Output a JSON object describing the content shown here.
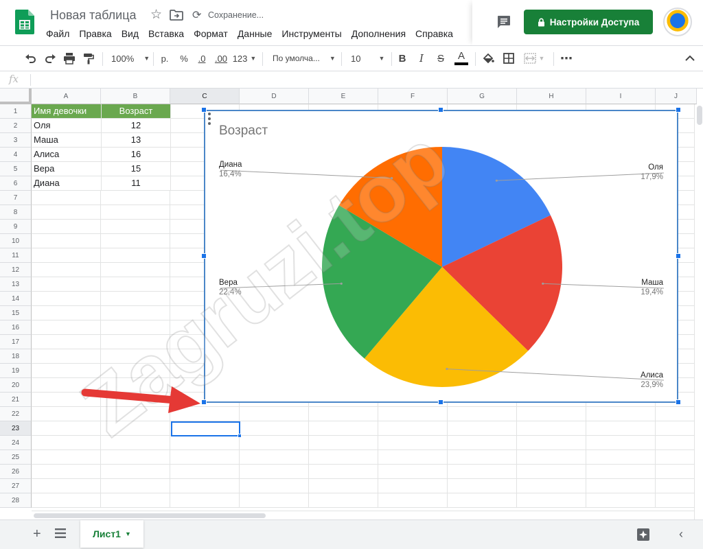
{
  "header": {
    "doc_title": "Новая таблица",
    "save_status": "Сохранение...",
    "share_label": "Настройки Доступа",
    "menu": [
      "Файл",
      "Правка",
      "Вид",
      "Вставка",
      "Формат",
      "Данные",
      "Инструменты",
      "Дополнения",
      "Справка"
    ]
  },
  "toolbar": {
    "zoom": "100%",
    "currency": "р.",
    "percent": "%",
    "dec_less": ".0",
    "dec_more": ".00",
    "more_formats": "123",
    "font": "По умолча...",
    "font_size": "10",
    "bold": "B",
    "italic": "I",
    "strike": "S",
    "text_color": "A",
    "more": "⋯"
  },
  "formula_bar": {
    "fx": "fx",
    "value": ""
  },
  "grid": {
    "columns": [
      "A",
      "B",
      "C",
      "D",
      "E",
      "F",
      "G",
      "H",
      "I",
      "J"
    ],
    "rows": [
      "1",
      "2",
      "3",
      "4",
      "5",
      "6",
      "7",
      "8",
      "9",
      "10",
      "11",
      "12",
      "13",
      "14",
      "15",
      "16",
      "17",
      "18",
      "19",
      "20",
      "21",
      "22",
      "23",
      "24",
      "25",
      "26",
      "27",
      "28"
    ],
    "selected_cell": "C23",
    "header_fill": "#6aa84f",
    "table_header": [
      "Имя девочки",
      "Возраст"
    ],
    "table_rows": [
      [
        "Оля",
        "12"
      ],
      [
        "Маша",
        "13"
      ],
      [
        "Алиса",
        "16"
      ],
      [
        "Вера",
        "15"
      ],
      [
        "Диана",
        "11"
      ]
    ]
  },
  "chart_data": {
    "type": "pie",
    "title": "Возраст",
    "categories": [
      "Оля",
      "Маша",
      "Алиса",
      "Вера",
      "Диана"
    ],
    "values": [
      12,
      13,
      16,
      15,
      11
    ],
    "percent_labels": [
      "17,9%",
      "19,4%",
      "23,9%",
      "22,4%",
      "16,4%"
    ],
    "colors": [
      "#4285f4",
      "#ea4335",
      "#fbbc04",
      "#34a853",
      "#ff6d01"
    ],
    "legend": "labeled",
    "start_angle_deg": 0,
    "direction": "clockwise"
  },
  "watermark": "Zagruzi.top",
  "bottom_bar": {
    "sheet_name": "Лист1"
  }
}
